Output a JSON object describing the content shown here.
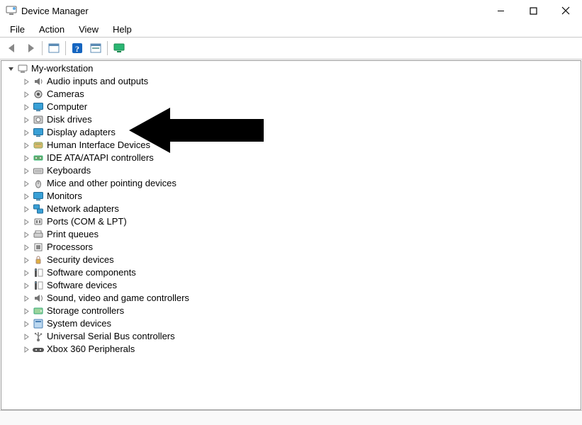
{
  "titlebar": {
    "title": "Device Manager"
  },
  "menu": {
    "items": [
      {
        "label": "File"
      },
      {
        "label": "Action"
      },
      {
        "label": "View"
      },
      {
        "label": "Help"
      }
    ]
  },
  "toolbar": {
    "items": [
      {
        "id": "back",
        "name": "back-icon",
        "icon": "arrow-left"
      },
      {
        "id": "forward",
        "name": "forward-icon",
        "icon": "arrow-right"
      },
      {
        "sep": true
      },
      {
        "id": "show",
        "name": "show-hide-icon",
        "icon": "panel"
      },
      {
        "sep": true
      },
      {
        "id": "help",
        "name": "help-icon",
        "icon": "help"
      },
      {
        "id": "scan",
        "name": "scan-hardware-icon",
        "icon": "panel2"
      },
      {
        "sep": true
      },
      {
        "id": "monitor",
        "name": "monitor-icon",
        "icon": "monitor-green"
      }
    ]
  },
  "tree": {
    "root": {
      "label": "My-workstation",
      "expanded": true,
      "icon": "computer"
    },
    "children": [
      {
        "label": "Audio inputs and outputs",
        "icon": "speaker"
      },
      {
        "label": "Cameras",
        "icon": "camera"
      },
      {
        "label": "Computer",
        "icon": "monitor"
      },
      {
        "label": "Disk drives",
        "icon": "disk"
      },
      {
        "label": "Display adapters",
        "icon": "monitor"
      },
      {
        "label": "Human Interface Devices",
        "icon": "hid"
      },
      {
        "label": "IDE ATA/ATAPI controllers",
        "icon": "controller"
      },
      {
        "label": "Keyboards",
        "icon": "keyboard"
      },
      {
        "label": "Mice and other pointing devices",
        "icon": "mouse"
      },
      {
        "label": "Monitors",
        "icon": "monitor"
      },
      {
        "label": "Network adapters",
        "icon": "network"
      },
      {
        "label": "Ports (COM & LPT)",
        "icon": "port"
      },
      {
        "label": "Print queues",
        "icon": "printer"
      },
      {
        "label": "Processors",
        "icon": "cpu"
      },
      {
        "label": "Security devices",
        "icon": "security"
      },
      {
        "label": "Software components",
        "icon": "software"
      },
      {
        "label": "Software devices",
        "icon": "software"
      },
      {
        "label": "Sound, video and game controllers",
        "icon": "sound"
      },
      {
        "label": "Storage controllers",
        "icon": "storage"
      },
      {
        "label": "System devices",
        "icon": "system"
      },
      {
        "label": "Universal Serial Bus controllers",
        "icon": "usb"
      },
      {
        "label": "Xbox 360 Peripherals",
        "icon": "gamepad"
      }
    ]
  },
  "annotation": {
    "target": "Display adapters"
  }
}
